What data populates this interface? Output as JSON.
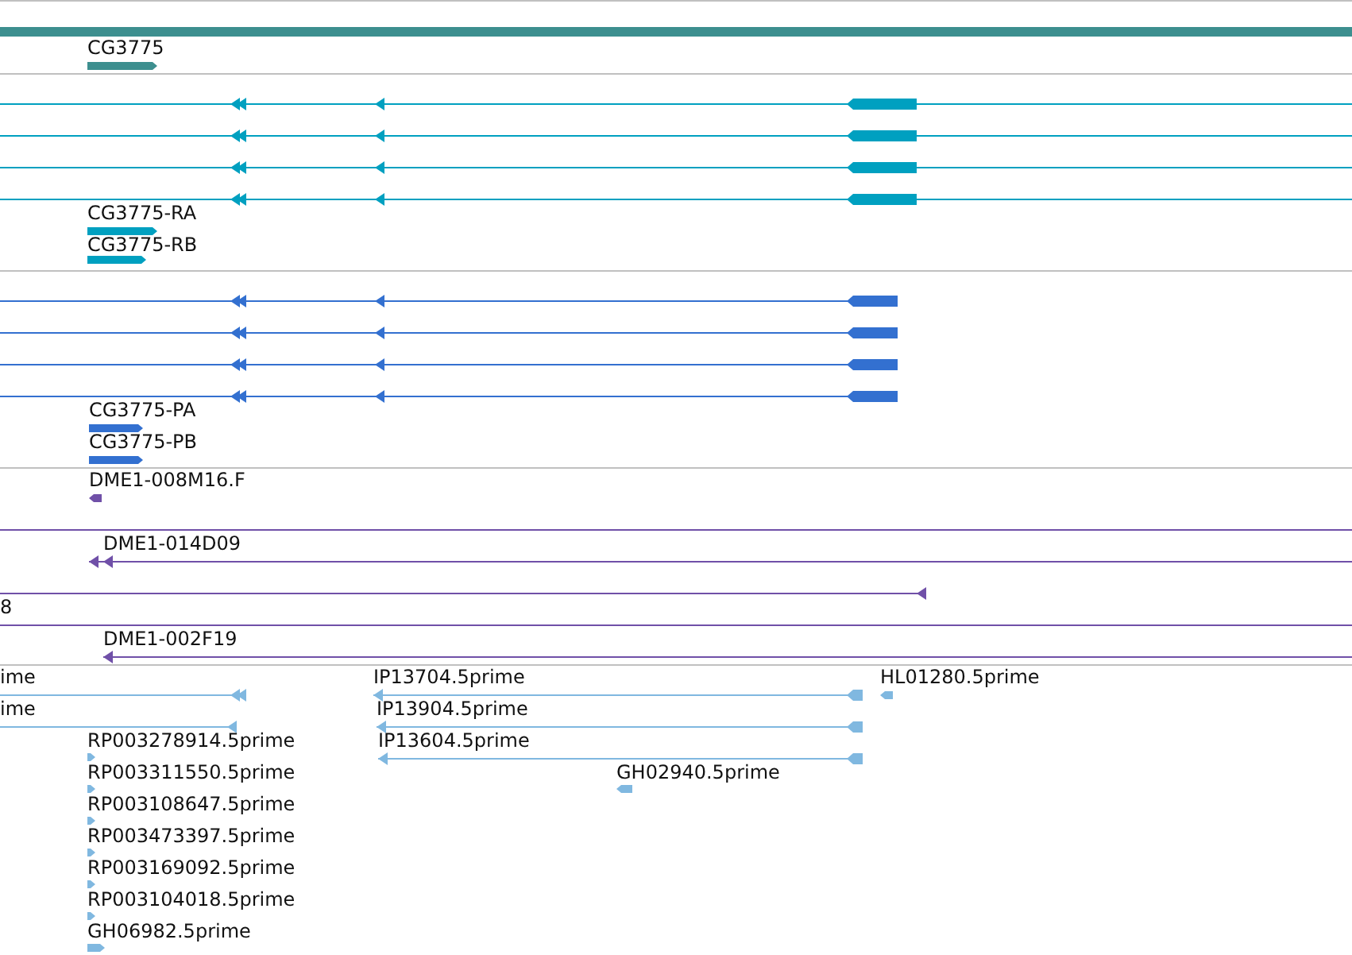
{
  "tracks": [
    {
      "kind": "gene",
      "color": "#3d8f8f",
      "labels": [
        "CG3775"
      ]
    },
    {
      "kind": "transcript",
      "color": "#00a0c0",
      "labels": [
        "CG3775-RA",
        "CG3775-RB"
      ]
    },
    {
      "kind": "protein",
      "color": "#3370d0",
      "labels": [
        "CG3775-PA",
        "CG3775-PB"
      ]
    },
    {
      "kind": "clone",
      "color": "#7050a8",
      "labels": [
        "DME1-008M16.F",
        "DME1-014D09",
        "8",
        "DME1-002F19"
      ]
    },
    {
      "kind": "est",
      "color": "#80b8e0",
      "labels": [
        "ime",
        "IP13704.5prime",
        "HL01280.5prime",
        "ime",
        "IP13904.5prime",
        "RP003278914.5prime",
        "IP13604.5prime",
        "RP003311550.5prime",
        "GH02940.5prime",
        "RP003108647.5prime",
        "RP003473397.5prime",
        "RP003169092.5prime",
        "RP003104018.5prime",
        "GH06982.5prime"
      ]
    }
  ]
}
